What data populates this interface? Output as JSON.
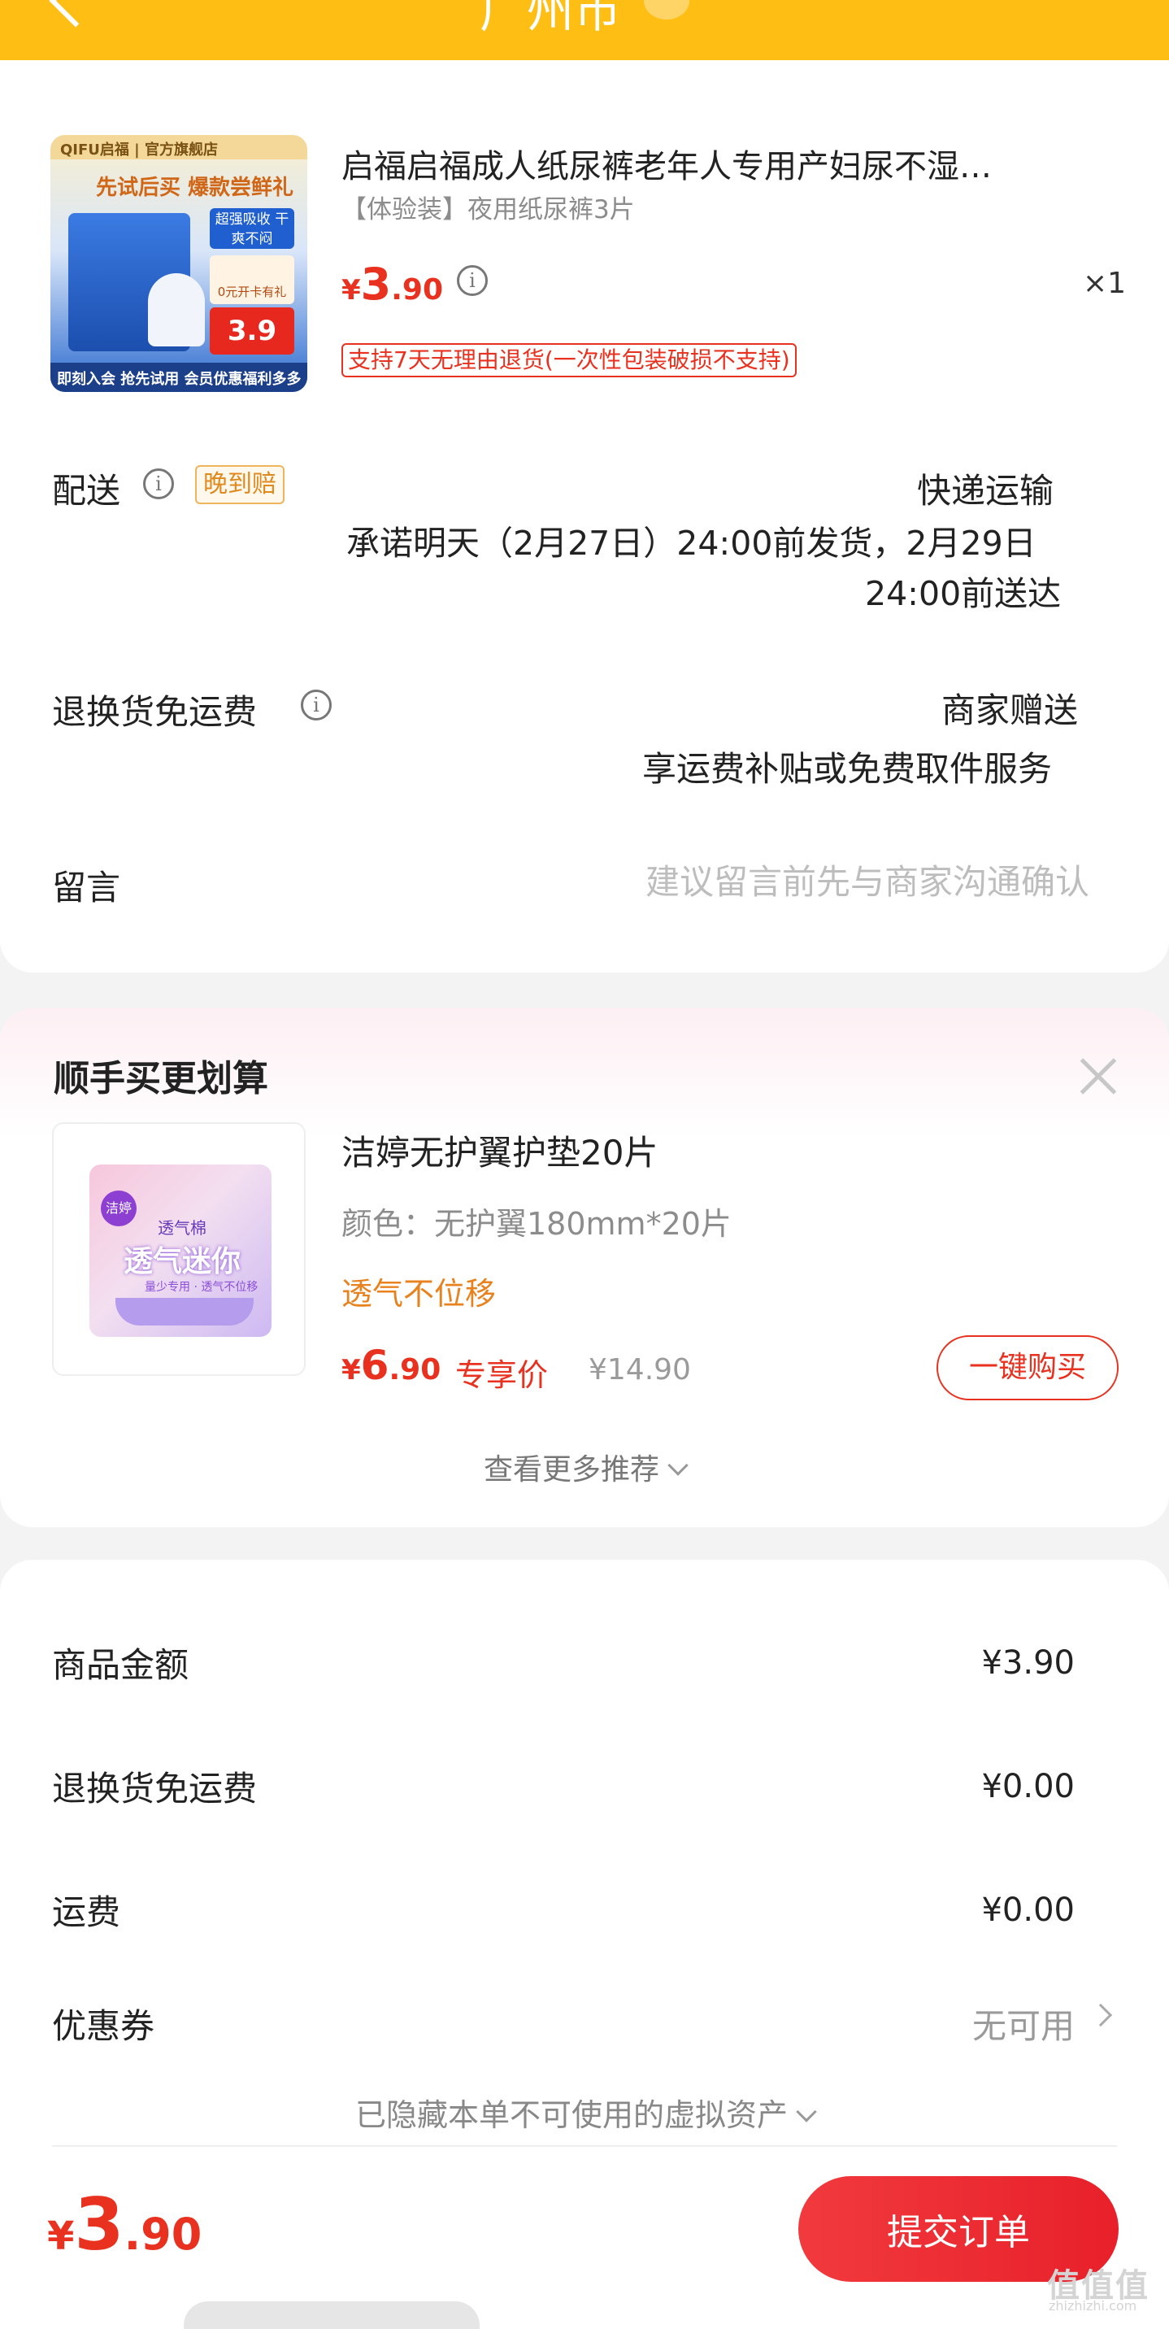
{
  "header": {
    "title": "广州市",
    "bg_color": "#FFBE14"
  },
  "product": {
    "image_text": {
      "brand": "QIFU启福 | 官方旗舰店",
      "slogan": "先试后买  爆款尝鲜礼",
      "tag": "超强吸收 干爽不闷",
      "gift": "0元开卡有礼",
      "price": "3.9",
      "bottom": "即刻入会 抢先试用 会员优惠福利多多"
    },
    "title": "启福启福成人纸尿裤老年人专用产妇尿不湿…",
    "spec": "【体验装】夜用纸尿裤3片",
    "price_currency": "¥",
    "price_int": "3",
    "price_dec": ".90",
    "quantity": "×1",
    "return_policy": "支持7天无理由退货(一次性包装破损不支持)"
  },
  "shipping": {
    "label": "配送",
    "badge": "晚到赔",
    "mode": "快递运输",
    "promise_line1": "承诺明天（2月27日）24:00前发货，2月29日",
    "promise_line2": "24:00前送达"
  },
  "return_shipping": {
    "label": "退换货免运费",
    "value": "商家赠送",
    "desc": "享运费补贴或免费取件服务"
  },
  "message": {
    "label": "留言",
    "placeholder": "建议留言前先与商家沟通确认"
  },
  "recommend": {
    "title": "顺手买更划算",
    "item": {
      "image_text": {
        "logo": "洁婷",
        "line1": "透气棉",
        "line2": "透气迷你",
        "line3": "量少专用 · 透气不位移"
      },
      "title": "洁婷无护翼护垫20片",
      "spec": "颜色：无护翼180mm*20片",
      "tag": "透气不位移",
      "price_currency": "¥",
      "price_int": "6",
      "price_dec": ".90",
      "exclusive_label": "专享价",
      "original_price": "¥14.90",
      "buy_label": "一键购买"
    },
    "more_label": "查看更多推荐"
  },
  "summary": {
    "items": [
      {
        "label": "商品金额",
        "value": "¥3.90"
      },
      {
        "label": "退换货免运费",
        "value": "¥0.00"
      },
      {
        "label": "运费",
        "value": "¥0.00"
      }
    ],
    "coupon_label": "优惠券",
    "coupon_value": "无可用",
    "hidden_assets": "已隐藏本单不可使用的虚拟资产"
  },
  "footer": {
    "total_currency": "¥",
    "total_int": "3",
    "total_dec": ".90",
    "submit_label": "提交订单",
    "watermark": "值值值",
    "watermark_sub": "zhizhizhi.com"
  },
  "colors": {
    "accent_red": "#e8321f",
    "orange": "#e8821e"
  }
}
